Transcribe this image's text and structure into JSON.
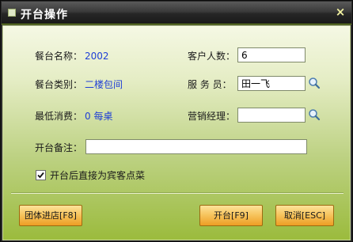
{
  "window": {
    "title": "开台操作",
    "close_glyph": "×"
  },
  "form": {
    "table_name_label": "餐台名称：",
    "table_name_value": "2002",
    "guest_count_label": "客户人数：",
    "guest_count_value": "6",
    "table_type_label": "餐台类别：",
    "table_type_value": "二楼包间",
    "waiter_label": "服 务 员：",
    "waiter_value": "田一飞",
    "min_spend_label": "最低消费：",
    "min_spend_value": "0 每桌",
    "sales_manager_label": "营销经理：",
    "sales_manager_value": "",
    "remark_label": "开台备注：",
    "remark_value": "",
    "order_checkbox_label": "开台后直接为宾客点菜",
    "order_checkbox_checked": true
  },
  "buttons": {
    "group_checkin": "团体进店[F8]",
    "open_table": "开台[F9]",
    "cancel": "取消[ESC]"
  },
  "icons": {
    "waiter_search": "search-icon",
    "manager_search": "search-icon"
  },
  "colors": {
    "value_text": "#1f3fd6",
    "button_orange": "#f6c25a",
    "panel_green": "#9bbb3d"
  }
}
